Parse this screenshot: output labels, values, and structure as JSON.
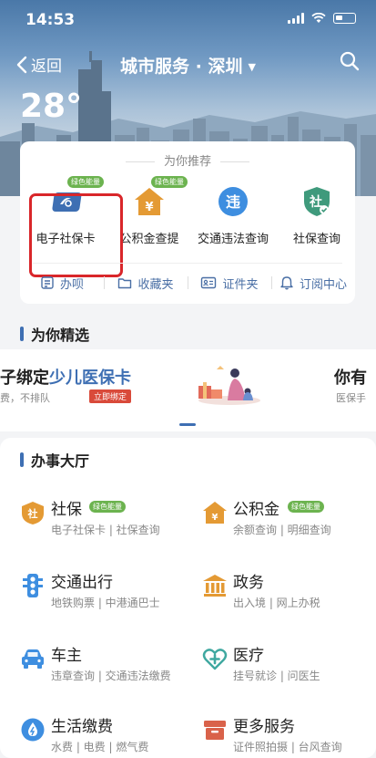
{
  "status_bar": {
    "time": "14:53"
  },
  "nav": {
    "back_label": "返回",
    "title": "城市服务 · 深圳"
  },
  "weather": {
    "temperature": "28°"
  },
  "recommend": {
    "title": "为你推荐",
    "items": [
      {
        "label": "电子社保卡",
        "badge": "绿色能量",
        "icon": "social-security-card-icon"
      },
      {
        "label": "公积金查提",
        "badge": "绿色能量",
        "icon": "housing-fund-icon"
      },
      {
        "label": "交通违法查询",
        "badge": "",
        "icon": "traffic-violation-icon"
      },
      {
        "label": "社保查询",
        "badge": "",
        "icon": "social-security-query-icon"
      }
    ],
    "actions": [
      {
        "label": "办呗",
        "icon": "task-icon"
      },
      {
        "label": "收藏夹",
        "icon": "folder-icon"
      },
      {
        "label": "证件夹",
        "icon": "id-card-icon"
      },
      {
        "label": "订阅中心",
        "icon": "bell-icon"
      }
    ]
  },
  "picks": {
    "title": "为你精选",
    "banner_left": {
      "title_prefix": "子绑定",
      "title_highlight": "少儿医保卡",
      "subtitle": "费，不排队",
      "button": "立即绑定"
    },
    "banner_right": {
      "title": "你有",
      "subtitle": "医保手"
    }
  },
  "hall": {
    "title": "办事大厅",
    "services": [
      {
        "name": "社保",
        "badge": "绿色能量",
        "subtitle": "电子社保卡 | 社保查询",
        "icon": "social-security-icon"
      },
      {
        "name": "公积金",
        "badge": "绿色能量",
        "subtitle": "余额查询 | 明细查询",
        "icon": "housing-fund-icon"
      },
      {
        "name": "交通出行",
        "badge": "",
        "subtitle": "地铁购票 | 中港通巴士",
        "icon": "traffic-light-icon"
      },
      {
        "name": "政务",
        "badge": "",
        "subtitle": "出入境 | 网上办税",
        "icon": "government-icon"
      },
      {
        "name": "车主",
        "badge": "",
        "subtitle": "违章查询 | 交通违法缴费",
        "icon": "car-icon"
      },
      {
        "name": "医疗",
        "badge": "",
        "subtitle": "挂号就诊 | 问医生",
        "icon": "medical-icon"
      },
      {
        "name": "生活缴费",
        "badge": "",
        "subtitle": "水费 | 电费 | 燃气费",
        "icon": "utility-icon"
      },
      {
        "name": "更多服务",
        "badge": "",
        "subtitle": "证件照拍摄 | 台风查询",
        "icon": "more-services-icon"
      }
    ]
  },
  "colors": {
    "accent": "#3e6fb3",
    "badge_green": "#6cb34f",
    "highlight_red": "#d9262a",
    "orange": "#e49a34"
  }
}
